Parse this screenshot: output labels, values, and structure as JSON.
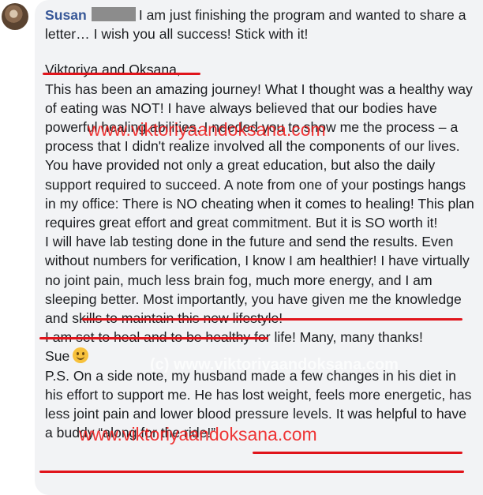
{
  "comment": {
    "author": "Susan",
    "intro": "I am just finishing the program and wanted to share a letter… I wish you all success! Stick with it!",
    "greeting": "Viktoriya and Oksana,",
    "para1": "This has been an amazing journey! What I thought was a healthy way of eating was NOT! I have always believed that our bodies have powerful healing abilities. I needed you to show me the process – a process that I didn't realize involved all the components of our lives.",
    "para2": "You have provided not only a great education, but also the daily support required to succeed. A note from one of your postings hangs in my office: There is NO cheating when it comes to healing! This plan requires great effort and great commitment. But it is SO worth it!",
    "para3": "I will have lab testing done in the future and send the results. Even without numbers for verification, I know I am healthier! I have virtually no joint pain, much less brain fog, much more energy, and I am sleeping better. Most importantly, you have given me the knowledge and skills to maintain this new lifestyle!",
    "para4": "I am set to heal and to be healthy for life! Many, many thanks!",
    "signoff": "Sue",
    "ps": "P.S. On a side note, my husband made a few changes in his diet in his effort to support me. He has lost weight, feels more energetic, has less joint pain and lower blood pressure levels. It was helpful to have a buddy “along for the ride!”"
  },
  "watermarks": {
    "site": "www.viktoriyaandoksana.com",
    "copyright": "(c) www.viktoriyaandoksana.com"
  },
  "colors": {
    "author": "#385898",
    "bubble": "#f2f3f5",
    "watermark": "#ee1c1c",
    "underline": "#e0141b"
  },
  "icons": [
    "avatar",
    "smiling-face-emoji"
  ]
}
